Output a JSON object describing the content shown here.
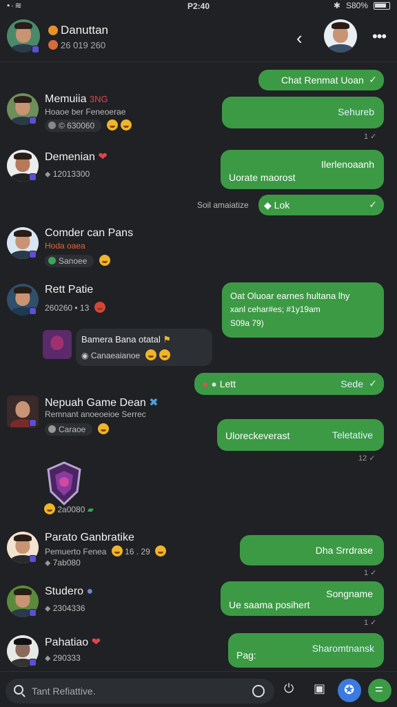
{
  "status": {
    "time": "P2:40",
    "left_icons": "•∙≋",
    "bluetooth": "✱",
    "battery": "S80%"
  },
  "header": {
    "title": "Danuttan",
    "subtitle": "26 019 260"
  },
  "contacts": [
    {
      "name": "Memuiia",
      "tag": "3NG",
      "sub": "Hoaoe ber Feneoerae",
      "meta": "© 630060"
    },
    {
      "name": "Demenian",
      "tag": "",
      "sub": "",
      "meta": "12013300"
    },
    {
      "name": "Comder can Pans",
      "tag": "",
      "sub": "Hoda oaea",
      "meta": "Sanoee"
    },
    {
      "name": "Rett Patie",
      "tag": "",
      "sub": "",
      "meta": "260260  • 13"
    },
    {
      "name": "Nepuah Game Dean",
      "tag": "",
      "sub": "Remnant anoeoeioe Serrec",
      "meta": "Caraoe"
    },
    {
      "name": "Parato Ganbratike",
      "tag": "",
      "sub": "Pemuerto Fenea",
      "meta": "7ab080"
    },
    {
      "name": "Studero",
      "tag": "",
      "sub": "",
      "meta": "2304336"
    },
    {
      "name": "Pahatiao",
      "tag": "",
      "sub": "",
      "meta": "290333"
    }
  ],
  "inbox_bubble": {
    "title": "Bamera Bana otatal",
    "sub": "Canaeaianoe"
  },
  "shield_meta": "2a0080",
  "bubbles": [
    {
      "text": "Chat Renmat Uoan",
      "check": "✓"
    },
    {
      "text": "Sehureb",
      "tick": "1 ✓"
    },
    {
      "text1": "Ilerlenoaanh",
      "text2": "Uorate maorost"
    },
    {
      "text": "Lok",
      "check": "✓",
      "note": "Soil amaiatize"
    },
    {
      "line1": "Oat Oluoar earnes hultana lhy",
      "line2": "xanl cehar#es; #1y19am",
      "line3": "S09a 79)"
    },
    {
      "text": "Lett",
      "right": "Sede",
      "check": "✓"
    },
    {
      "text1": "Uloreckeverast",
      "text2": "Teletative",
      "tick": "12 ✓"
    },
    {
      "text": "Dha Srrdrase",
      "tick": "1 ✓"
    },
    {
      "text1": "Songname",
      "text2": "Ue saama posihert",
      "tick": "1 ✓"
    },
    {
      "text1": "Sharomtnansk",
      "text2": "Pag:"
    }
  ],
  "search": {
    "placeholder": "Tant Refiattive."
  },
  "colors": {
    "bubble_green": "#3c9a45",
    "background": "#1f2124",
    "accent_blue": "#3b7ae0"
  }
}
